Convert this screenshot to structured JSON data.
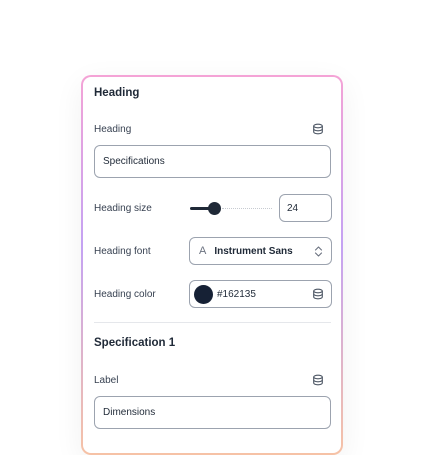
{
  "heading_section": {
    "title": "Heading",
    "heading_label": "Heading",
    "heading_value": "Specifications",
    "heading_size_label": "Heading size",
    "heading_size_value": "24",
    "heading_size_slider_fraction": 0.29,
    "heading_font_label": "Heading font",
    "heading_font_glyph": "A",
    "heading_font_value": "Instrument Sans",
    "heading_color_label": "Heading color",
    "heading_color_value": "#162135"
  },
  "specification_section": {
    "title": "Specification 1",
    "label_label": "Label",
    "label_value": "Dimensions"
  },
  "icons": {
    "data_source": "database-icon",
    "select_chevrons": "chevron-up-down-icon"
  },
  "colors": {
    "swatch": "#162135",
    "panel_border_top": "#f4a3d6",
    "panel_border_mid": "#c4a2f3",
    "panel_border_bottom": "#f6c2a6"
  }
}
